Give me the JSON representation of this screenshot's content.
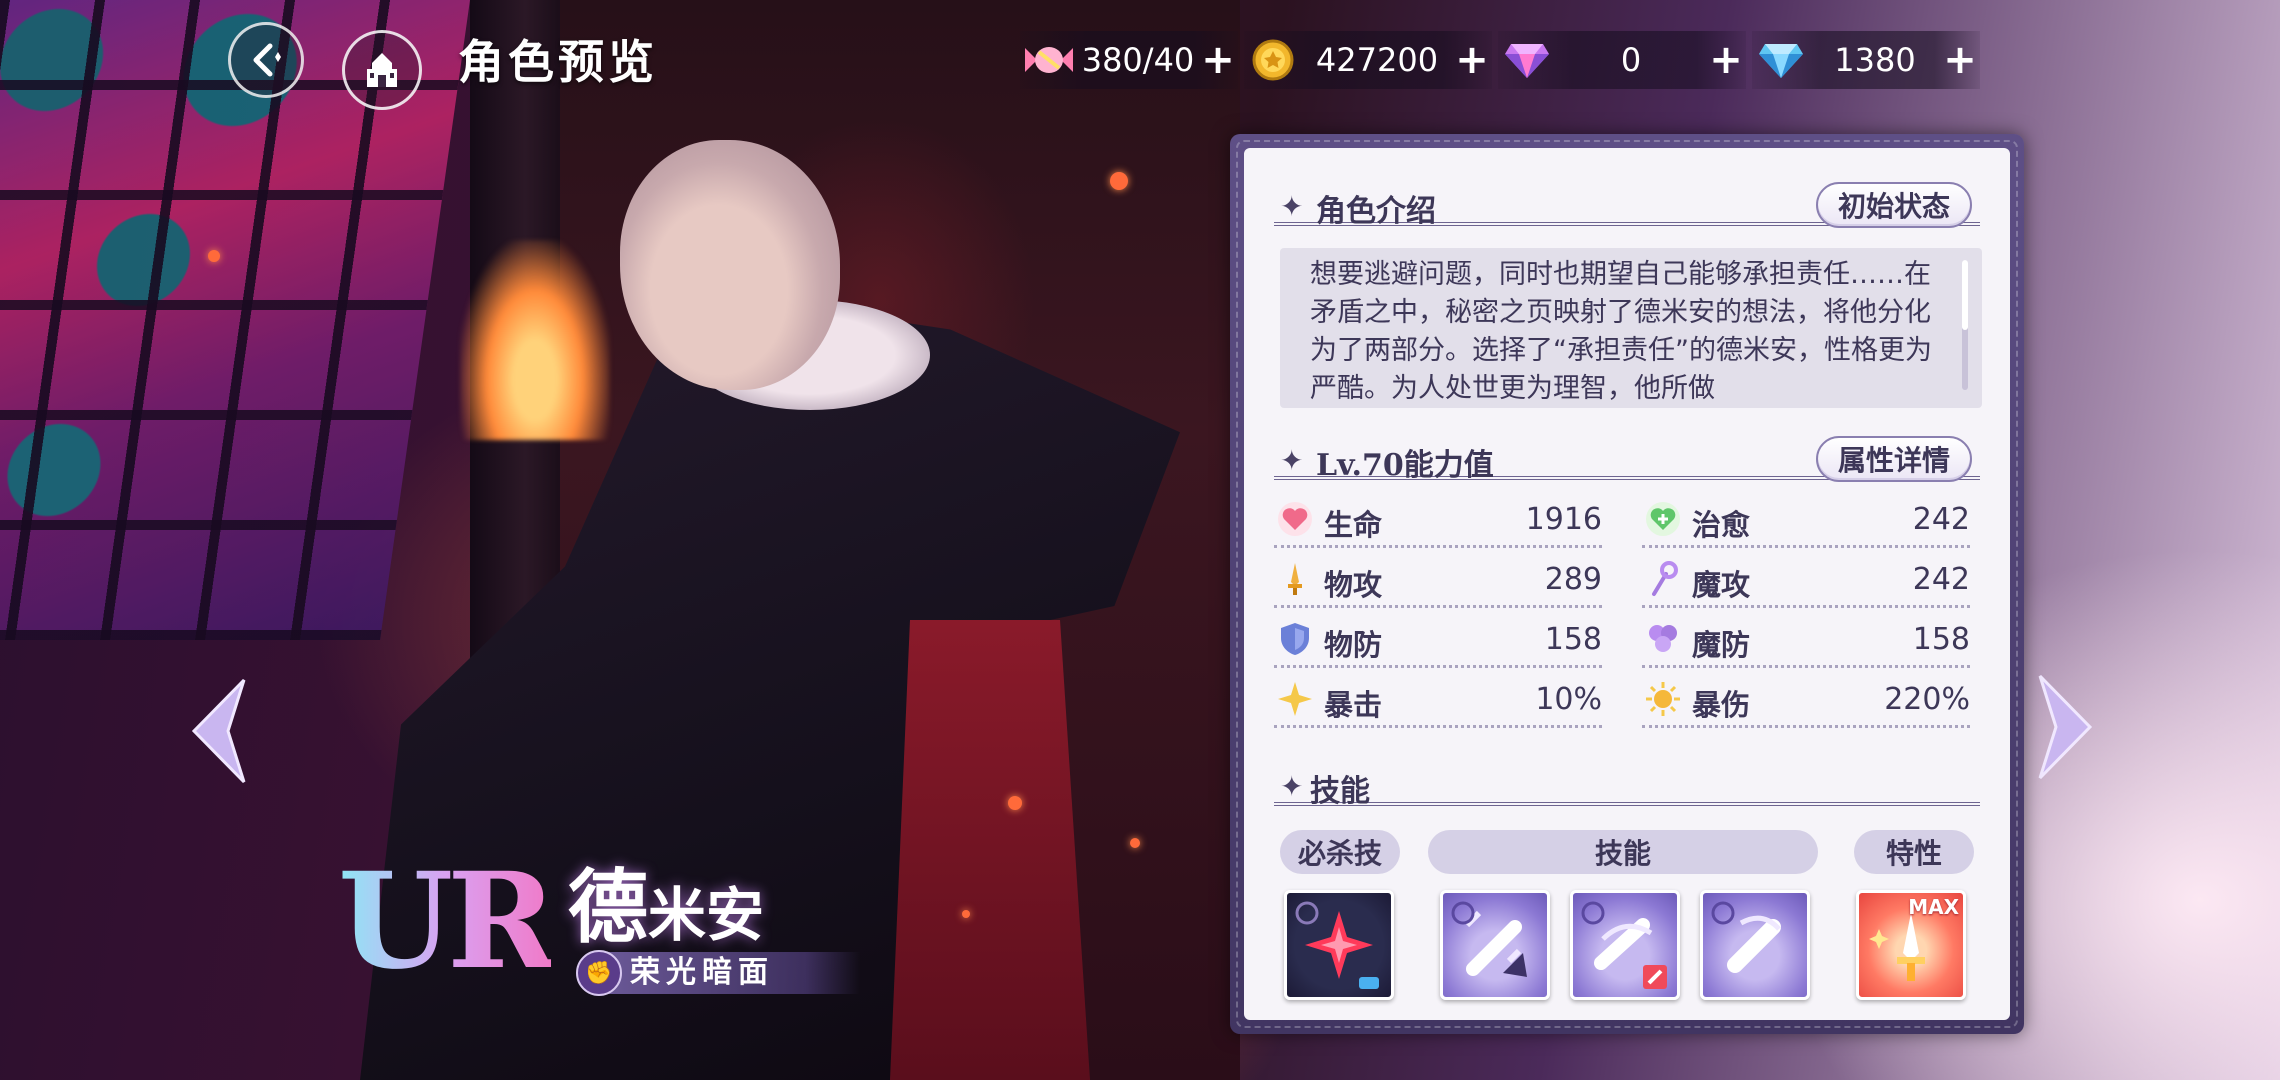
{
  "header": {
    "title": "角色预览"
  },
  "currencies": [
    {
      "icon": "candy-icon",
      "value": "380/40"
    },
    {
      "icon": "gold-coin-icon",
      "value": "427200"
    },
    {
      "icon": "pink-gem-icon",
      "value": "0"
    },
    {
      "icon": "blue-diamond-icon",
      "value": "1380"
    }
  ],
  "character": {
    "rarity": "UR",
    "name_large": "德",
    "name_small": "米安",
    "epithet": "荣光暗面"
  },
  "panel": {
    "intro": {
      "title": "角色介绍",
      "button": "初始状态",
      "description": "想要逃避问题，同时也期望自己能够承担责任……在矛盾之中，秘密之页映射了德米安的想法，将他分化为了两部分。选择了“承担责任”的德米安，性格更为严酷。为人处世更为理智，他所做"
    },
    "stats_section": {
      "title": "Lv.70能力值",
      "button": "属性详情"
    },
    "stats": [
      {
        "label": "生命",
        "value": "1916",
        "icon": "heart-icon"
      },
      {
        "label": "治愈",
        "value": "242",
        "icon": "heal-icon"
      },
      {
        "label": "物攻",
        "value": "289",
        "icon": "physical-attack-icon"
      },
      {
        "label": "魔攻",
        "value": "242",
        "icon": "magic-attack-icon"
      },
      {
        "label": "物防",
        "value": "158",
        "icon": "physical-defense-icon"
      },
      {
        "label": "魔防",
        "value": "158",
        "icon": "magic-defense-icon"
      },
      {
        "label": "暴击",
        "value": "10%",
        "icon": "crit-icon"
      },
      {
        "label": "暴伤",
        "value": "220%",
        "icon": "crit-damage-icon"
      }
    ],
    "skills_section": {
      "title": "技能",
      "tabs": [
        "必杀技",
        "技能",
        "特性"
      ],
      "max_badge": "MAX"
    }
  },
  "colors": {
    "panel_frame": "#5e4f86",
    "panel_bg": "#f6f4f9",
    "text_primary": "#3d3758",
    "arrow": "#c9b6f0"
  }
}
